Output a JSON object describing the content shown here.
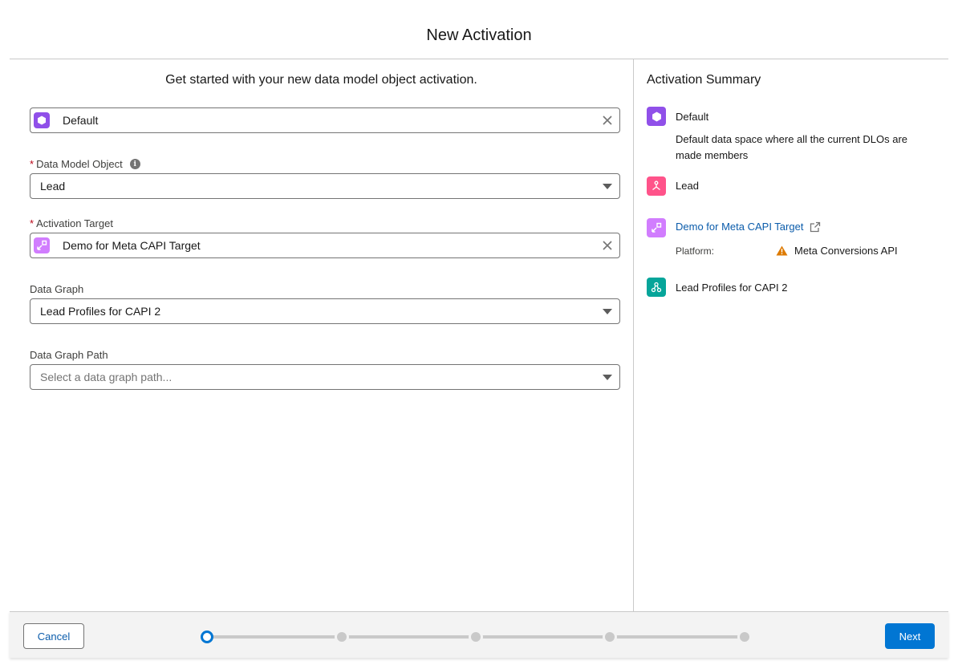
{
  "modal": {
    "title": "New Activation"
  },
  "form": {
    "intro": "Get started with your new data model object activation.",
    "data_space": {
      "value": "Default"
    },
    "data_model_object": {
      "label": "Data Model Object",
      "value": "Lead"
    },
    "activation_target": {
      "label": "Activation Target",
      "value": "Demo for Meta CAPI Target"
    },
    "data_graph": {
      "label": "Data Graph",
      "value": "Lead Profiles for CAPI 2"
    },
    "data_graph_path": {
      "label": "Data Graph Path",
      "placeholder": "Select a data graph path..."
    }
  },
  "summary": {
    "title": "Activation Summary",
    "data_space": {
      "name": "Default",
      "description": "Default data space where all the current DLOs are made members"
    },
    "dmo": {
      "name": "Lead"
    },
    "target": {
      "name": "Demo for Meta CAPI Target",
      "platform_label": "Platform:",
      "platform_value": "Meta Conversions API"
    },
    "data_graph": {
      "name": "Lead Profiles for CAPI 2"
    }
  },
  "footer": {
    "cancel_label": "Cancel",
    "next_label": "Next",
    "steps_total": 5,
    "current_step": 1
  },
  "colors": {
    "data_space_icon": "#9050e9",
    "dmo_icon": "#ff538a",
    "target_icon": "#d17dfe",
    "data_graph_icon": "#06a59a",
    "brand": "#0176d3",
    "link": "#0b5cab",
    "warning": "#dd7a01"
  },
  "icons": {
    "data_space": "hexagon-icon",
    "dmo": "object-icon",
    "target": "activation-target-icon",
    "data_graph": "data-graph-icon",
    "clear": "close-icon",
    "dropdown": "chevron-down-icon",
    "external": "external-link-icon",
    "warning": "warning-icon",
    "info": "info-icon"
  }
}
